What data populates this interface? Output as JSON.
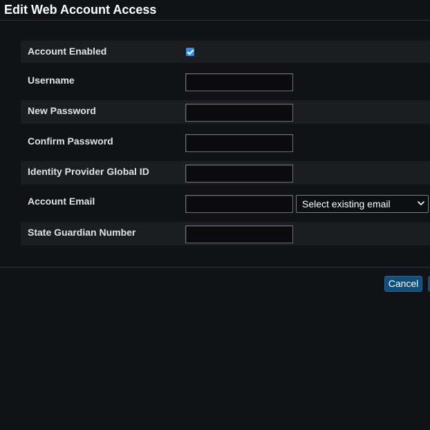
{
  "dialog": {
    "title": "Edit Web Account Access"
  },
  "form": {
    "account_enabled": {
      "label": "Account Enabled",
      "checked": true
    },
    "username": {
      "label": "Username",
      "value": ""
    },
    "new_password": {
      "label": "New Password",
      "value": ""
    },
    "confirm_password": {
      "label": "Confirm Password",
      "value": ""
    },
    "identity_provider_global_id": {
      "label": "Identity Provider Global ID",
      "value": ""
    },
    "account_email": {
      "label": "Account Email",
      "value": "",
      "select_value": "Select existing email"
    },
    "state_guardian_number": {
      "label": "State Guardian Number",
      "value": ""
    }
  },
  "footer": {
    "cancel_label": "Cancel"
  },
  "colors": {
    "background": "#111215",
    "row_shade": "#1b1d21",
    "accent": "#2f8ee6",
    "button": "#0e4f7e"
  }
}
